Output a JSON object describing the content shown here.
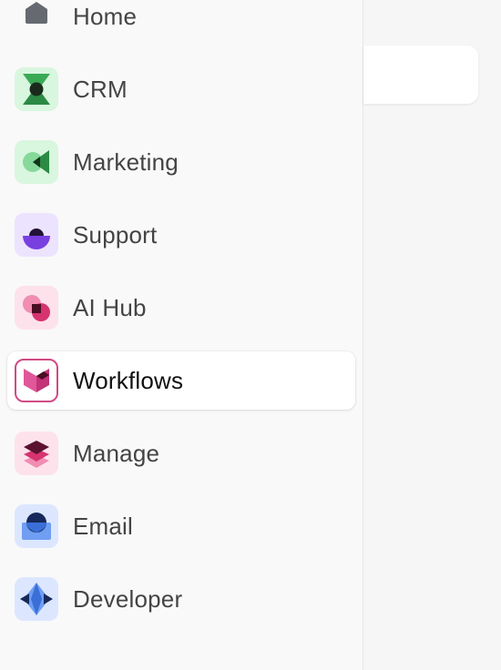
{
  "sidebar": {
    "items": [
      {
        "label": "Home",
        "icon": "home-icon",
        "color": "#5f6368"
      },
      {
        "label": "CRM",
        "icon": "crm-icon",
        "color": "#2e8b45"
      },
      {
        "label": "Marketing",
        "icon": "marketing-icon",
        "color": "#2e8b45"
      },
      {
        "label": "Support",
        "icon": "support-icon",
        "color": "#7b3fe4"
      },
      {
        "label": "AI Hub",
        "icon": "ai-hub-icon",
        "color": "#d0336f"
      },
      {
        "label": "Workflows",
        "icon": "workflows-icon",
        "color": "#d04a85",
        "active": true
      },
      {
        "label": "Manage",
        "icon": "manage-icon",
        "color": "#c23a7a"
      },
      {
        "label": "Email",
        "icon": "email-icon",
        "color": "#3b6fd8"
      },
      {
        "label": "Developer",
        "icon": "developer-icon",
        "color": "#3b6fd8"
      }
    ]
  }
}
